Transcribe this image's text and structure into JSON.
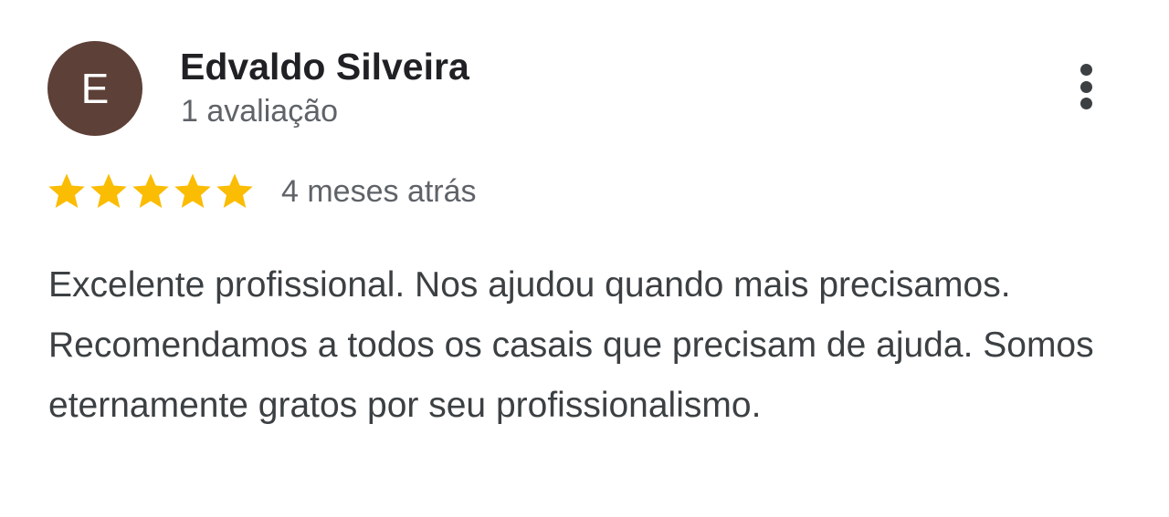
{
  "review": {
    "avatar_letter": "E",
    "avatar_color": "#5d4037",
    "author_name": "Edvaldo Silveira",
    "review_count": "1 avaliação",
    "rating": 5,
    "max_rating": 5,
    "star_color": "#fbbc04",
    "time_ago": "4 meses atrás",
    "text": "Excelente profissional. Nos ajudou quando mais precisamos. Recomendamos a todos os casais que precisam de ajuda. Somos eternamente gratos por seu profissionalismo.",
    "more_icon": "more-vert-icon"
  }
}
